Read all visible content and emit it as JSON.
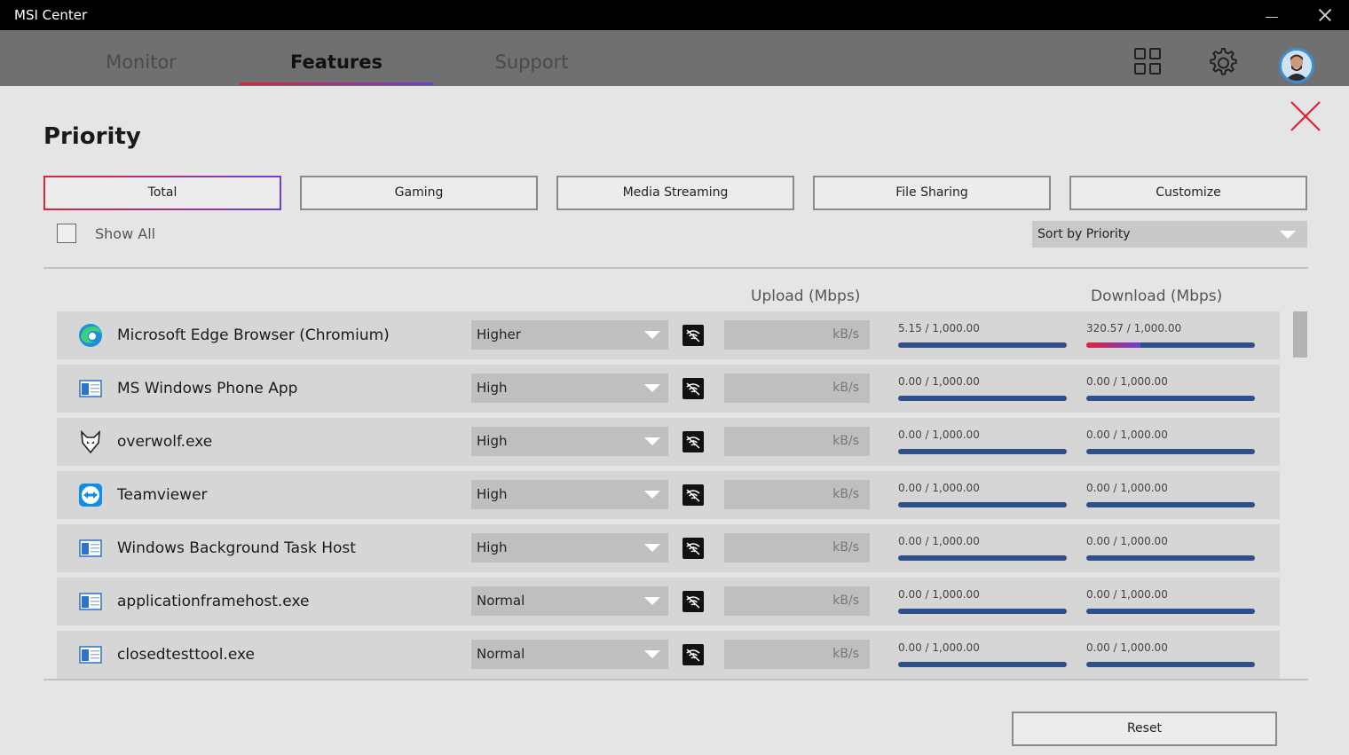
{
  "window": {
    "title": "MSI Center"
  },
  "nav": {
    "tabs": [
      {
        "label": "Monitor"
      },
      {
        "label": "Features"
      },
      {
        "label": "Support"
      }
    ],
    "active_tab": "Features"
  },
  "page": {
    "title": "Priority"
  },
  "priority_buttons": [
    {
      "label": "Total"
    },
    {
      "label": "Gaming"
    },
    {
      "label": "Media Streaming"
    },
    {
      "label": "File Sharing"
    },
    {
      "label": "Customize"
    }
  ],
  "active_priority_button": "Total",
  "show_all": {
    "label": "Show All",
    "checked": false
  },
  "sort": {
    "value": "Sort by Priority"
  },
  "columns": {
    "upload": "Upload (Mbps)",
    "download": "Download (Mbps)"
  },
  "rows": [
    {
      "name": "Microsoft Edge Browser (Chromium)",
      "icon": "edge-icon",
      "priority": "Higher",
      "unit": "kB/s",
      "upload": "5.15 / 1,000.00",
      "download": "320.57 / 1,000.00",
      "upload_fraction": 0.005,
      "download_fraction": 0.32057
    },
    {
      "name": "MS Windows Phone App",
      "icon": "app-window-icon",
      "priority": "High",
      "unit": "kB/s",
      "upload": "0.00 / 1,000.00",
      "download": "0.00 / 1,000.00",
      "upload_fraction": 0,
      "download_fraction": 0
    },
    {
      "name": "overwolf.exe",
      "icon": "overwolf-icon",
      "priority": "High",
      "unit": "kB/s",
      "upload": "0.00 / 1,000.00",
      "download": "0.00 / 1,000.00",
      "upload_fraction": 0,
      "download_fraction": 0
    },
    {
      "name": "Teamviewer",
      "icon": "teamviewer-icon",
      "priority": "High",
      "unit": "kB/s",
      "upload": "0.00 / 1,000.00",
      "download": "0.00 / 1,000.00",
      "upload_fraction": 0,
      "download_fraction": 0
    },
    {
      "name": "Windows Background Task Host",
      "icon": "app-window-icon",
      "priority": "High",
      "unit": "kB/s",
      "upload": "0.00 / 1,000.00",
      "download": "0.00 / 1,000.00",
      "upload_fraction": 0,
      "download_fraction": 0
    },
    {
      "name": "applicationframehost.exe",
      "icon": "app-window-icon",
      "priority": "Normal",
      "unit": "kB/s",
      "upload": "0.00 / 1,000.00",
      "download": "0.00 / 1,000.00",
      "upload_fraction": 0,
      "download_fraction": 0
    },
    {
      "name": "closedtesttool.exe",
      "icon": "app-window-icon",
      "priority": "Normal",
      "unit": "kB/s",
      "upload": "0.00 / 1,000.00",
      "download": "0.00 / 1,000.00",
      "upload_fraction": 0,
      "download_fraction": 0
    }
  ],
  "reset": {
    "label": "Reset"
  },
  "colors": {
    "accent_start": "#e0233b",
    "accent_end": "#6b3fd1",
    "bar_track": "#2f4f8a",
    "close_red": "#e0233b"
  }
}
